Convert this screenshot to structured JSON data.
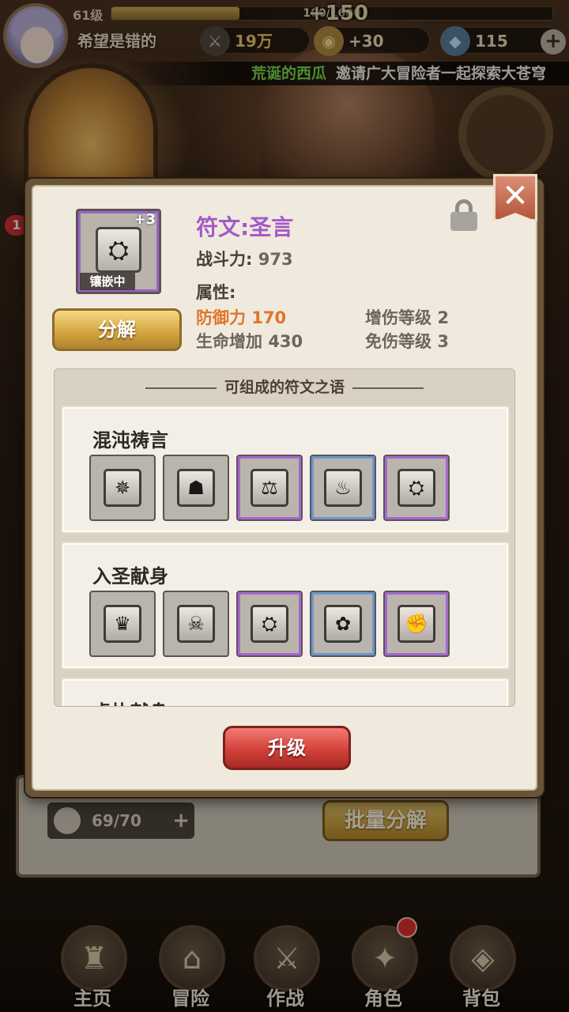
{
  "hud": {
    "level": "61级",
    "exp_text": "100/1600",
    "exp_fraction": 0.29,
    "exp_gain": "+150",
    "player_name": "希望是错的",
    "power": "19万",
    "gold": "+30",
    "gems": "115",
    "plus_symbol": "+"
  },
  "marquee": {
    "sender": "荒诞的西瓜",
    "message": "邀请广大冒险者一起探索大苍穹"
  },
  "side_badge": "1",
  "rune": {
    "name": "符文:圣言",
    "plus_level": "+3",
    "inlaid_tag": "镶嵌中",
    "power_label": "战斗力:",
    "power_value": "973",
    "attr_label": "属性:",
    "attributes": [
      {
        "name": "防御力",
        "value": "170",
        "highlight": true
      },
      {
        "name": "增伤等级",
        "value": "2",
        "highlight": false
      },
      {
        "name": "生命增加",
        "value": "430",
        "highlight": false
      },
      {
        "name": "免伤等级",
        "value": "3",
        "highlight": false
      }
    ],
    "decompose_label": "分解",
    "close_symbol": "✕"
  },
  "compose": {
    "header": "可组成的符文之语",
    "words": [
      {
        "title": "混沌祷言",
        "runes": [
          {
            "icon": "winged-halo-icon",
            "glyph": "✵",
            "quality": "gray"
          },
          {
            "icon": "demon-head-icon",
            "glyph": "☗",
            "quality": "gray"
          },
          {
            "icon": "scales-icon",
            "glyph": "⚖",
            "quality": "purple"
          },
          {
            "icon": "flame-icon",
            "glyph": "♨",
            "quality": "blue"
          },
          {
            "icon": "holy-tome-icon",
            "glyph": "⛭",
            "quality": "purple"
          }
        ]
      },
      {
        "title": "入圣献身",
        "runes": [
          {
            "icon": "crown-icon",
            "glyph": "♛",
            "quality": "gray"
          },
          {
            "icon": "skull-icon",
            "glyph": "☠",
            "quality": "gray"
          },
          {
            "icon": "holy-tome-icon",
            "glyph": "⛭",
            "quality": "purple"
          },
          {
            "icon": "vortex-icon",
            "glyph": "✿",
            "quality": "blue"
          },
          {
            "icon": "fist-icon",
            "glyph": "✊",
            "quality": "purple"
          }
        ]
      },
      {
        "title": "虔执献身",
        "runes": []
      }
    ]
  },
  "upgrade_label": "升级",
  "inventory": {
    "count": "69/70",
    "plus_symbol": "+",
    "batch_label": "批量分解"
  },
  "nav": [
    {
      "label": "主页",
      "icon": "angel-statue-icon",
      "glyph": "♜",
      "dot": false
    },
    {
      "label": "冒险",
      "icon": "gate-icon",
      "glyph": "⌂",
      "dot": false
    },
    {
      "label": "作战",
      "icon": "hero-girl-icon",
      "glyph": "⚔",
      "dot": false
    },
    {
      "label": "角色",
      "icon": "spellbook-icon",
      "glyph": "✦",
      "dot": true
    },
    {
      "label": "背包",
      "icon": "backpack-icon",
      "glyph": "◈",
      "dot": false
    }
  ]
}
